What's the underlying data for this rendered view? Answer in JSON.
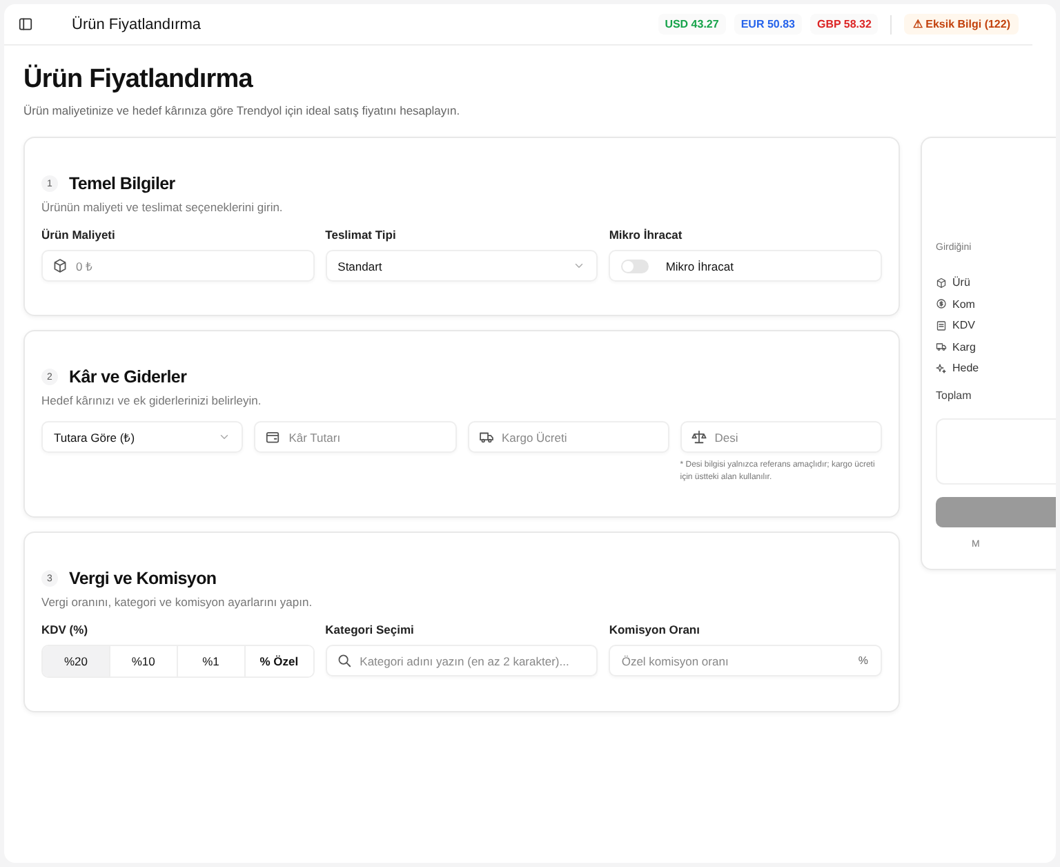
{
  "topbar": {
    "title": "Ürün Fiyatlandırma",
    "rates": [
      {
        "code": "USD",
        "value": "43.27",
        "color": "#16a34a"
      },
      {
        "code": "EUR",
        "value": "50.83",
        "color": "#2563eb"
      },
      {
        "code": "GBP",
        "value": "58.32",
        "color": "#dc2626"
      }
    ],
    "warning": {
      "icon": "⚠",
      "label": "Eksik Bilgi (122)"
    }
  },
  "page": {
    "title": "Ürün Fiyatlandırma",
    "subtitle": "Ürün maliyetinize ve hedef kârınıza göre Trendyol için ideal satış fiyatını hesaplayın."
  },
  "sections": [
    {
      "number": "1",
      "title": "Temel Bilgiler",
      "subtitle": "Ürünün maliyeti ve teslimat seçeneklerini girin.",
      "fields": [
        {
          "kind": "input",
          "label": "Ürün Maliyeti",
          "placeholder": "0 ₺"
        },
        {
          "kind": "select",
          "label": "Teslimat Tipi",
          "value": "Standart"
        },
        {
          "kind": "toggle",
          "label": "Mikro İhracat",
          "text": "Mikro İhracat",
          "on": false
        }
      ]
    },
    {
      "number": "2",
      "title": "Kâr ve Giderler",
      "subtitle": "Hedef kârınızı ve ek giderlerinizi belirleyin.",
      "fields": [
        {
          "kind": "select",
          "value": "Tutara Göre (₺)"
        },
        {
          "kind": "input",
          "placeholder": "Kâr Tutarı"
        },
        {
          "kind": "input",
          "placeholder": "Kargo Ücreti"
        },
        {
          "kind": "input",
          "placeholder": "Desi",
          "note": "* Desi bilgisi yalnızca referans amaçlıdır; kargo ücreti için üstteki alan kullanılır."
        }
      ]
    },
    {
      "number": "3",
      "title": "Vergi ve Komisyon",
      "subtitle": "Vergi oranını, kategori ve komisyon ayarlarını yapın.",
      "fields": [
        {
          "kind": "segmented",
          "label": "KDV (%)",
          "options": [
            {
              "label": "%20",
              "selected": true
            },
            {
              "label": "%10",
              "selected": false
            },
            {
              "label": "%1",
              "selected": false
            },
            {
              "label": "Özel",
              "icon": "%",
              "selected": false
            }
          ]
        },
        {
          "kind": "input",
          "label": "Kategori Seçimi",
          "placeholder": "Kategori adını yazın (en az 2 karakter)..."
        },
        {
          "kind": "input",
          "label": "Komisyon Oranı",
          "placeholder": "Özel komisyon oranı",
          "suffix": "%"
        }
      ]
    }
  ],
  "summary": {
    "intro": "Girdiğini",
    "items": [
      {
        "label": "Ürü"
      },
      {
        "label": "Kom"
      },
      {
        "label": "KDV"
      },
      {
        "label": "Karg"
      },
      {
        "label": "Hede"
      }
    ],
    "total_label": "Toplam",
    "footer": "M"
  }
}
